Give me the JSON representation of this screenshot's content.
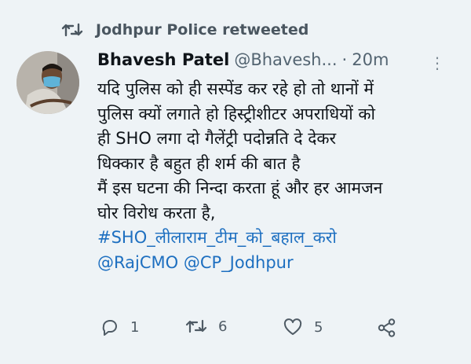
{
  "retweet_banner": {
    "text": "Jodhpur Police retweeted"
  },
  "tweet": {
    "display_name": "Bhavesh Patel",
    "handle": "@Bhavesh...",
    "separator": "·",
    "time": "20m",
    "text_lines": [
      "यदि पुलिस को ही सस्पेंड कर रहे हो तो थानों में",
      "पुलिस क्यों लगाते हो हिस्ट्रीशीटर अपराधियों को",
      "ही SHO लगा दो गैलेंट्री पदोन्नति दे देकर",
      "धिक्कार है बहुत ही शर्म की बात है",
      "मैं इस घटना की निन्दा करता हूं और हर आमजन",
      "घोर विरोध करता है,"
    ],
    "hashtag": "#SHO_लीलाराम_टीम_को_बहाल_करो",
    "mention_1": "@RajCMO",
    "mention_2": "@CP_Jodhpur"
  },
  "actions": {
    "reply_count": "1",
    "retweet_count": "6",
    "like_count": "5"
  },
  "icons": {
    "retweet": "retweet-icon",
    "more": "more-icon",
    "reply": "reply-icon",
    "like": "heart-icon",
    "share": "share-icon"
  },
  "colors": {
    "link": "#1d6fc0",
    "muted": "#536471",
    "background": "#eef3f6"
  }
}
